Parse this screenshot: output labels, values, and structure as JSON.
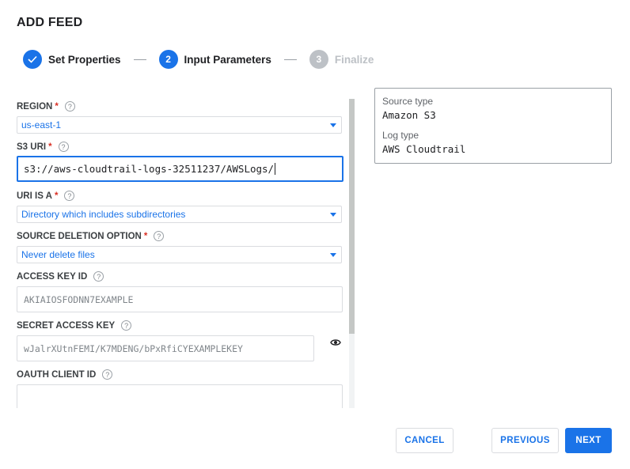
{
  "dialog": {
    "title": "ADD FEED"
  },
  "stepper": {
    "steps": [
      {
        "number": "",
        "label": "Set Properties",
        "state": "done"
      },
      {
        "number": "2",
        "label": "Input Parameters",
        "state": "active"
      },
      {
        "number": "3",
        "label": "Finalize",
        "state": "todo"
      }
    ],
    "check_icon": "check-icon"
  },
  "form": {
    "region": {
      "label": "REGION",
      "required": "*",
      "value": "us-east-1"
    },
    "s3_uri": {
      "label": "S3 URI",
      "required": "*",
      "value": "s3://aws-cloudtrail-logs-32511237/AWSLogs/"
    },
    "uri_is_a": {
      "label": "URI IS A",
      "required": "*",
      "value": "Directory which includes subdirectories"
    },
    "source_deletion": {
      "label": "SOURCE DELETION OPTION",
      "required": "*",
      "value": "Never delete files"
    },
    "access_key_id": {
      "label": "ACCESS KEY ID",
      "placeholder": "AKIAIOSFODNN7EXAMPLE"
    },
    "secret_access_key": {
      "label": "SECRET ACCESS KEY",
      "placeholder": "wJalrXUtnFEMI/K7MDENG/bPxRfiCYEXAMPLEKEY",
      "visibility_icon": "eye-icon"
    },
    "oauth_client_id": {
      "label": "OAUTH CLIENT ID",
      "value": ""
    },
    "help_glyph": "?"
  },
  "info": {
    "source_type_label": "Source type",
    "source_type_value": "Amazon S3",
    "log_type_label": "Log type",
    "log_type_value": "AWS Cloudtrail"
  },
  "footer": {
    "cancel_label": "CANCEL",
    "previous_label": "PREVIOUS",
    "next_label": "NEXT"
  },
  "colors": {
    "accent": "#1a73e8",
    "required": "#d93025",
    "disabled_step": "#bdc1c6"
  }
}
